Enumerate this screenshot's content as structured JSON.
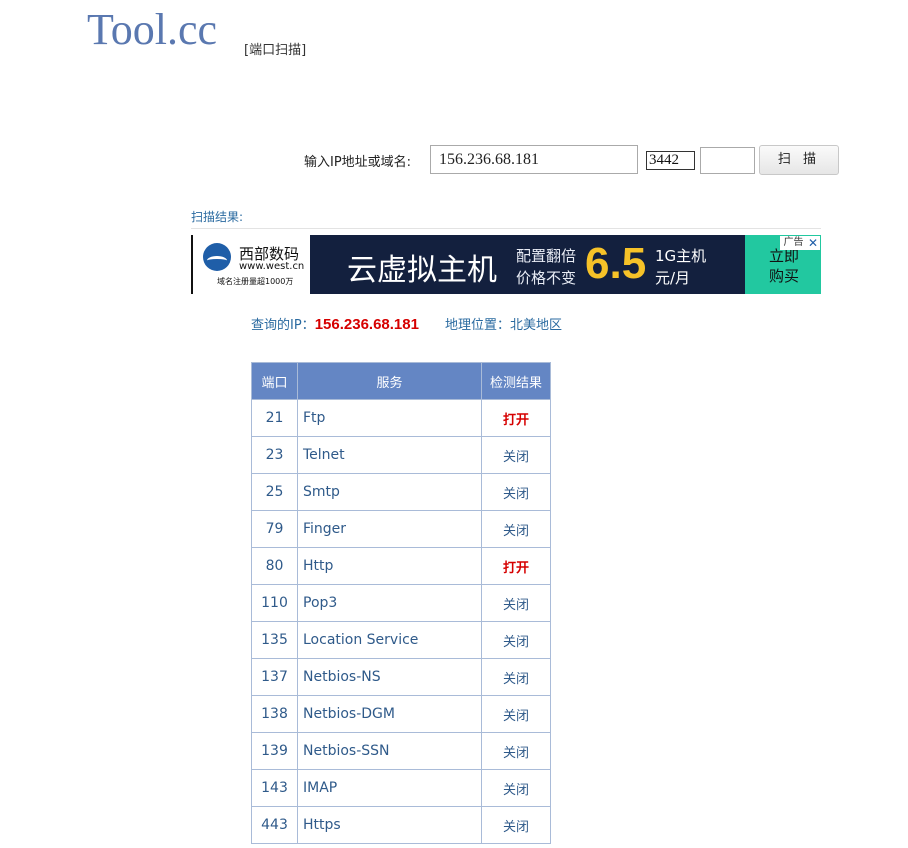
{
  "header": {
    "logo": "Tool.cc",
    "subtitle": "[端口扫描]"
  },
  "scan": {
    "label": "输入IP地址或域名:",
    "ip_value": "156.236.68.181",
    "port_value": "3442",
    "extra_port_value": "",
    "button_label": "扫 描"
  },
  "results": {
    "title": "扫描结果:",
    "ip_label": "查询的IP：",
    "ip_value": "156.236.68.181",
    "geo_label": "地理位置：",
    "geo_value": "北美地区"
  },
  "ad": {
    "brand": "西部数码",
    "url": "www.west.cn",
    "note": "域名注册量超1000万",
    "headline": "云虚拟主机",
    "line1": "配置翻倍",
    "line2": "价格不变",
    "price": "6.5",
    "unit1": "1G主机",
    "unit2": "元/月",
    "cta_line1": "立即",
    "cta_line2": "购买",
    "tag": "广告",
    "close": "✕",
    "colors": {
      "background": "#13203e",
      "price": "#f6c228",
      "cta": "#22c8a0"
    }
  },
  "table": {
    "headers": [
      "端口",
      "服务",
      "检测结果"
    ],
    "rows": [
      {
        "port": "21",
        "service": "Ftp",
        "result": "打开",
        "open": true
      },
      {
        "port": "23",
        "service": "Telnet",
        "result": "关闭",
        "open": false
      },
      {
        "port": "25",
        "service": "Smtp",
        "result": "关闭",
        "open": false
      },
      {
        "port": "79",
        "service": "Finger",
        "result": "关闭",
        "open": false
      },
      {
        "port": "80",
        "service": "Http",
        "result": "打开",
        "open": true
      },
      {
        "port": "110",
        "service": "Pop3",
        "result": "关闭",
        "open": false
      },
      {
        "port": "135",
        "service": "Location Service",
        "result": "关闭",
        "open": false
      },
      {
        "port": "137",
        "service": "Netbios-NS",
        "result": "关闭",
        "open": false
      },
      {
        "port": "138",
        "service": "Netbios-DGM",
        "result": "关闭",
        "open": false
      },
      {
        "port": "139",
        "service": "Netbios-SSN",
        "result": "关闭",
        "open": false
      },
      {
        "port": "143",
        "service": "IMAP",
        "result": "关闭",
        "open": false
      },
      {
        "port": "443",
        "service": "Https",
        "result": "关闭",
        "open": false
      }
    ]
  },
  "colors": {
    "header_bg": "#6486c4",
    "open": "#d60000",
    "text": "#2f5a8a",
    "logo": "#5a78b0"
  }
}
